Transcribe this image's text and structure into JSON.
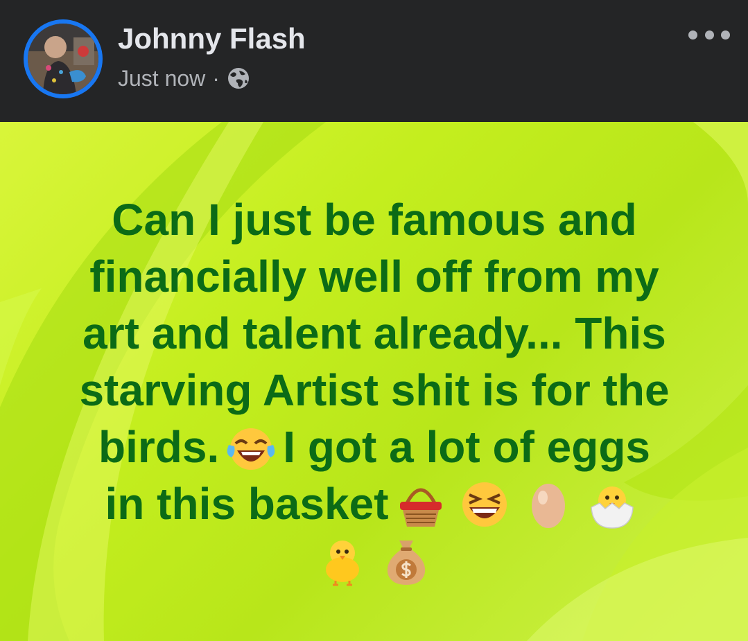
{
  "post": {
    "author": "Johnny Flash",
    "timestamp": "Just now",
    "separator": "·",
    "privacy_icon": "globe-icon",
    "more_icon": "more-options-icon",
    "text_lines": {
      "l1": "Can I just be famous and",
      "l2": "financially well off from my",
      "l3": "art and talent already... This",
      "l4": "starving Artist shit is for the",
      "l5a": "birds.",
      "l5b": "I got a lot of eggs",
      "l6": "in this basket"
    },
    "emojis": [
      "laughing-tears-emoji",
      "basket-emoji",
      "grinning-squint-emoji",
      "egg-emoji",
      "hatching-chick-emoji",
      "baby-chick-emoji",
      "money-bag-emoji"
    ]
  },
  "colors": {
    "header_bg": "#242526",
    "name_text": "#e4e6eb",
    "meta_text": "#b0b3b8",
    "avatar_ring": "#1877f2",
    "post_text": "#0b6b16",
    "post_bg": "#c4ee1e"
  }
}
